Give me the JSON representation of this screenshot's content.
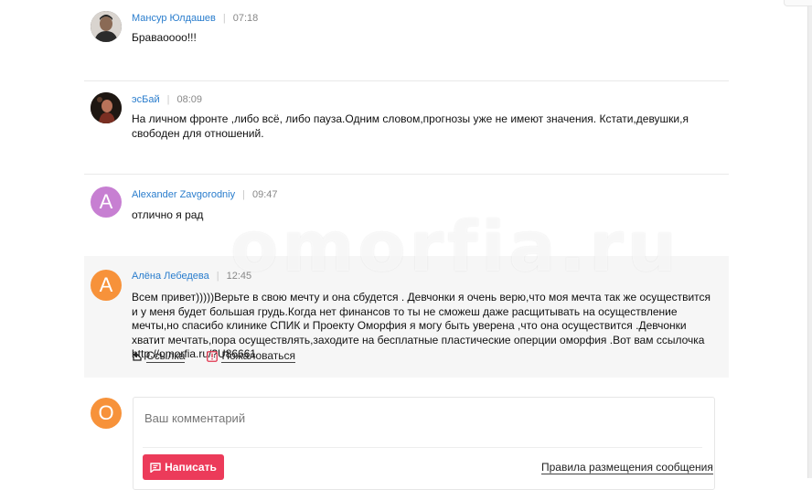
{
  "comments": [
    {
      "author": "Мансур Юлдашев",
      "time": "07:18",
      "text": "Браваоооо!!!",
      "avatar_icon": "user-photo-icon"
    },
    {
      "author": "эсБай",
      "time": "08:09",
      "text": "На личном фронте ,либо всё, либо пауза.Одним словом,прогнозы уже не имеют значения. Кстати,девушки,я свободен для отношений.",
      "avatar_icon": "user-photo-icon"
    },
    {
      "author": "Alexander Zavgorodniy",
      "time": "09:47",
      "text": "отлично я рад",
      "avatar_letter": "A",
      "avatar_color": "#c77fd2"
    },
    {
      "author": "Алёна Лебедева",
      "time": "12:45",
      "text": "Всем привет)))))Верьте в свою мечту и она сбудется . Девчонки я очень верю,что моя мечта так же осуществится и у меня будет большая грудь.Когда нет финансов то ты не сможеш даже расщитывать на осуществление мечты,но спасибо клинике СПИК и Проекту Оморфия я могу быть уверена ,что она осуществится .Девчонки хватит мечтать,пора осуществлять,заходите на бесплатные пластические оперции оморфия .Вот вам ссылочка http://omorfia.ru/?U86661",
      "avatar_letter": "А",
      "avatar_color": "#f7923a",
      "actions": {
        "link_label": "Ссылка",
        "complain_label": "Пожаловаться"
      }
    }
  ],
  "watermark": "omorfia.ru",
  "composer": {
    "avatar_letter": "О",
    "avatar_color": "#f7923a",
    "placeholder": "Ваш комментарий",
    "submit_label": "Написать",
    "rules_label": "Правила размещения сообщения"
  },
  "colors": {
    "author": "#2a7dcd",
    "accent": "#ec3b5a",
    "highlight_bg": "#f6f6f6"
  }
}
